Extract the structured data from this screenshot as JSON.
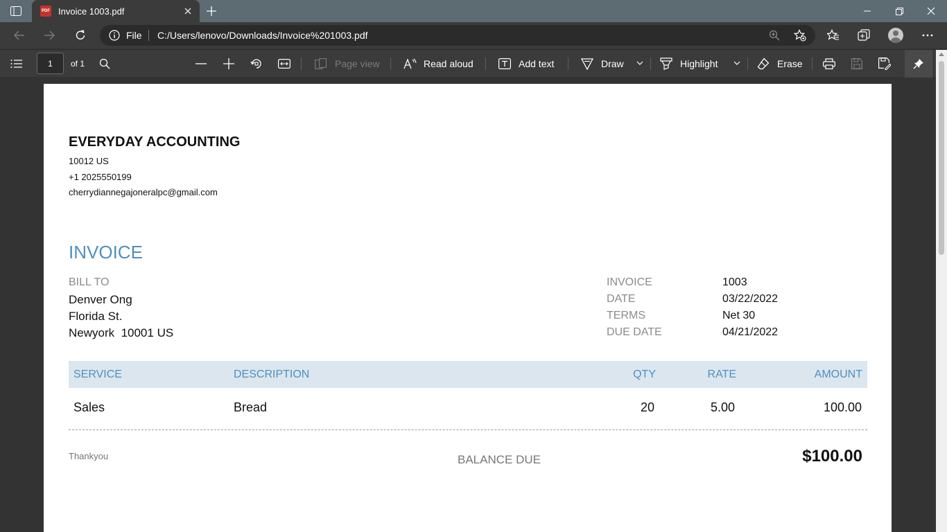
{
  "browser": {
    "tab_title": "Invoice 1003.pdf",
    "address_scheme_label": "File",
    "url": "C:/Users/lenovo/Downloads/Invoice%201003.pdf"
  },
  "pdf_toolbar": {
    "page_number": "1",
    "page_of": "of 1",
    "page_view_label": "Page view",
    "read_aloud_label": "Read aloud",
    "add_text_label": "Add text",
    "draw_label": "Draw",
    "highlight_label": "Highlight",
    "erase_label": "Erase"
  },
  "invoice": {
    "company": "EVERYDAY ACCOUNTING",
    "company_address": "10012 US",
    "company_phone": "+1 2025550199",
    "company_email": "cherrydiannegajoneralpc@gmail.com",
    "title": "INVOICE",
    "bill_to_label": "BILL TO",
    "bill_to": [
      "Denver Ong",
      "Florida St.",
      "Newyork  10001 US"
    ],
    "meta": [
      {
        "label": "INVOICE",
        "value": "1003"
      },
      {
        "label": "DATE",
        "value": "03/22/2022"
      },
      {
        "label": "TERMS",
        "value": "Net 30"
      },
      {
        "label": "DUE DATE",
        "value": "04/21/2022"
      }
    ],
    "columns": {
      "service": "SERVICE",
      "description": "DESCRIPTION",
      "qty": "QTY",
      "rate": "RATE",
      "amount": "AMOUNT"
    },
    "rows": [
      {
        "service": "Sales",
        "description": "Bread",
        "qty": "20",
        "rate": "5.00",
        "amount": "100.00"
      }
    ],
    "note": "Thankyou",
    "balance_due_label": "BALANCE DUE",
    "balance_due": "$100.00"
  },
  "colors": {
    "accent_blue": "#4f8fbf",
    "table_header_bg": "#dbe6ef",
    "pdf_icon_red": "#c7312b"
  }
}
